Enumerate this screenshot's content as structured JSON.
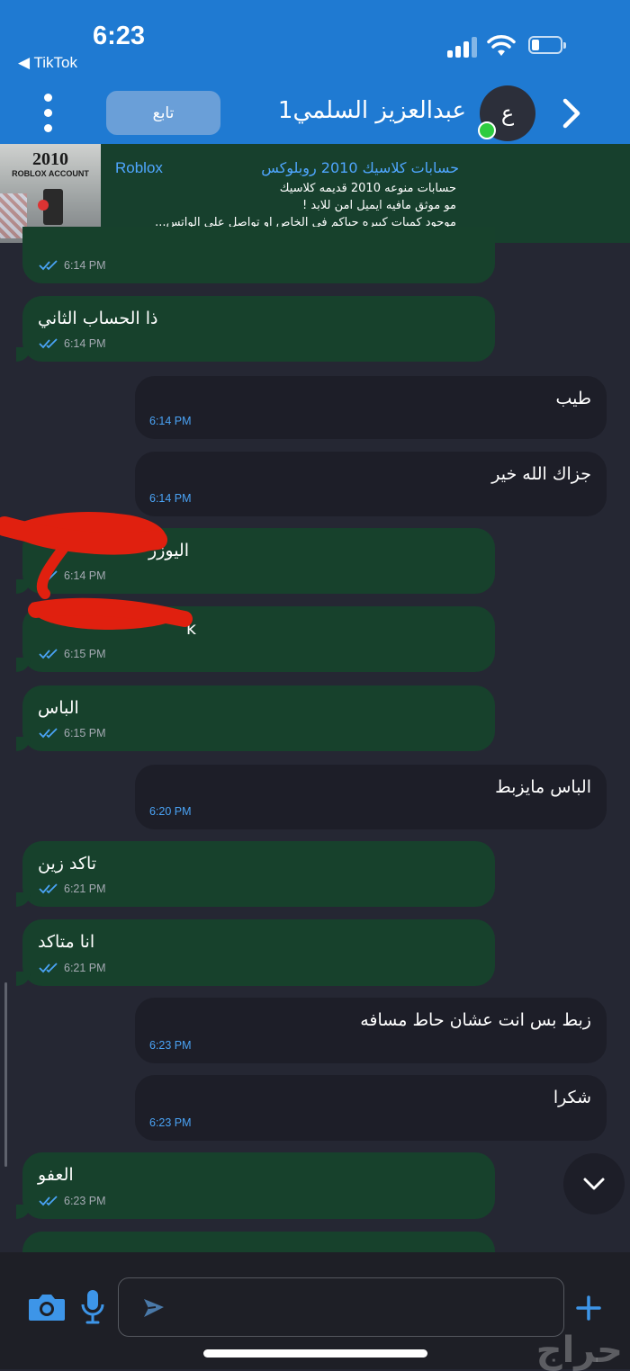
{
  "status_bar": {
    "time": "6:23",
    "back_app": "◀ TikTok"
  },
  "header": {
    "follow_label": "تابع",
    "contact_name": "عبدالعزيز السلمي1",
    "avatar_initial": "ع",
    "online": true
  },
  "ad": {
    "thumb_title": "2010",
    "thumb_subtitle": "ROBLOX ACCOUNT",
    "title_ar": "حسابات كلاسيك 2010 روبلوكس",
    "title_en": "Roblox",
    "lines": [
      "حسابات منوعه 2010 قديمه كلاسيك",
      "مو موثق مافيه ايميل امن للابد !",
      "موجود كميات كبيره حياكم في الخاص او تواصل على الواتس..."
    ]
  },
  "messages": [
    {
      "dir": "sent",
      "text": "",
      "time": "6:14 PM"
    },
    {
      "dir": "sent",
      "text": "ذا الحساب الثاني",
      "time": "6:14 PM"
    },
    {
      "dir": "recv",
      "text": "طيب",
      "time": "6:14 PM"
    },
    {
      "dir": "recv",
      "text": "جزاك الله خير",
      "time": "6:14 PM"
    },
    {
      "dir": "sent",
      "text": "اليوزر",
      "time": "6:14 PM"
    },
    {
      "dir": "sent",
      "text": "k",
      "time": "6:15 PM"
    },
    {
      "dir": "sent",
      "text": "الباس",
      "time": "6:15 PM"
    },
    {
      "dir": "recv",
      "text": "الباس مايزبط",
      "time": "6:20 PM"
    },
    {
      "dir": "sent",
      "text": "تاكد زين",
      "time": "6:21 PM"
    },
    {
      "dir": "sent",
      "text": "انا متاكد",
      "time": "6:21 PM"
    },
    {
      "dir": "recv",
      "text": "زبط بس انت عشان حاط مسافه",
      "time": "6:23 PM"
    },
    {
      "dir": "recv",
      "text": "شكرا",
      "time": "6:23 PM"
    },
    {
      "dir": "sent",
      "text": "العفو",
      "time": "6:23 PM"
    }
  ],
  "input": {
    "placeholder": ""
  },
  "watermark": "حراج",
  "colors": {
    "header_blue": "#1f7ad2",
    "sent_bubble": "#17412c",
    "recv_bubble": "#1d1e28",
    "background": "#252733",
    "link_blue": "#4fa6ff",
    "online_green": "#2ecc40"
  }
}
